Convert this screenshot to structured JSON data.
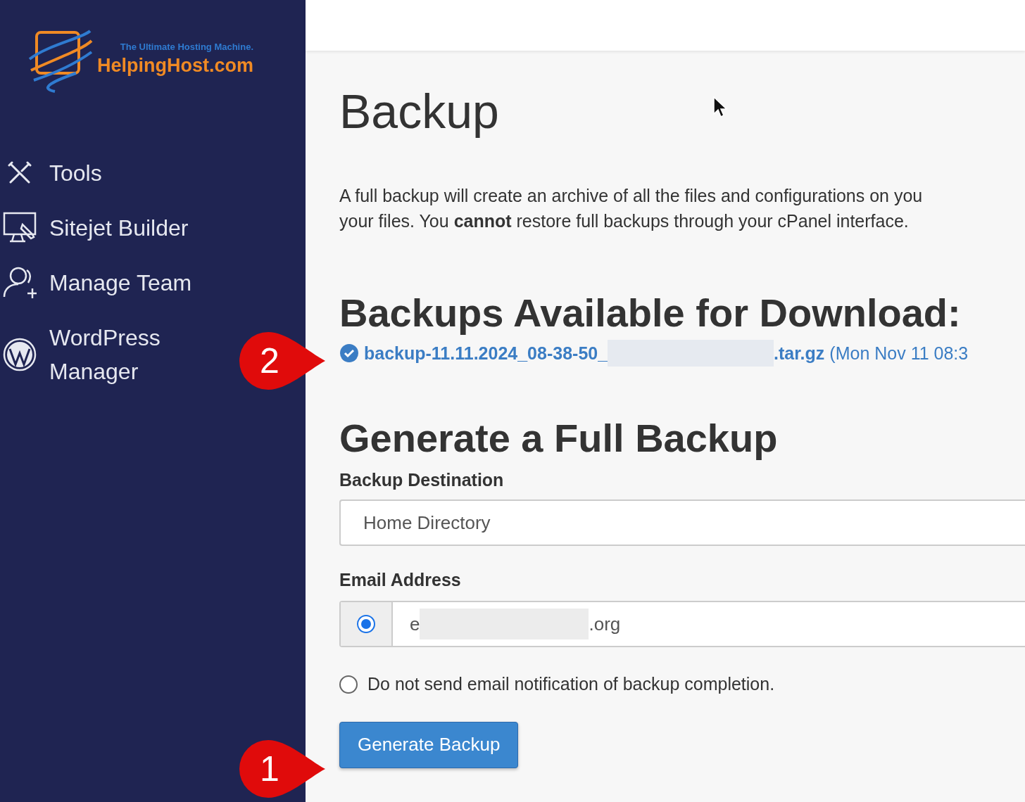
{
  "logo": {
    "tagline": "The Ultimate Hosting Machine.",
    "name": "HelpingHost.com"
  },
  "sidebar": {
    "items": [
      {
        "label": "Tools"
      },
      {
        "label": "Sitejet Builder"
      },
      {
        "label": "Manage Team"
      },
      {
        "label": "WordPress Manager"
      }
    ]
  },
  "page": {
    "title": "Backup",
    "intro_lines": [
      "A full backup will create an archive of all the files and configurations on you",
      "your files. You **cannot** restore full backups through your cPanel interface."
    ]
  },
  "downloads": {
    "heading": "Backups Available for Download:",
    "items": [
      {
        "name_start": "backup-11.11.2024_08-38-50_",
        "name_end": ".tar.gz",
        "date": "(Mon Nov 11 08:3"
      }
    ]
  },
  "generate": {
    "heading": "Generate a Full Backup",
    "destination": {
      "label": "Backup Destination",
      "value": "Home Directory"
    },
    "email": {
      "label": "Email Address",
      "options": [
        {
          "kind": "address",
          "selected": true,
          "value_start": "e",
          "value_end": ".org"
        },
        {
          "kind": "none",
          "selected": false,
          "label": "Do not send email notification of backup completion."
        }
      ]
    },
    "button": "Generate Backup"
  },
  "callouts": [
    "2",
    "1"
  ]
}
